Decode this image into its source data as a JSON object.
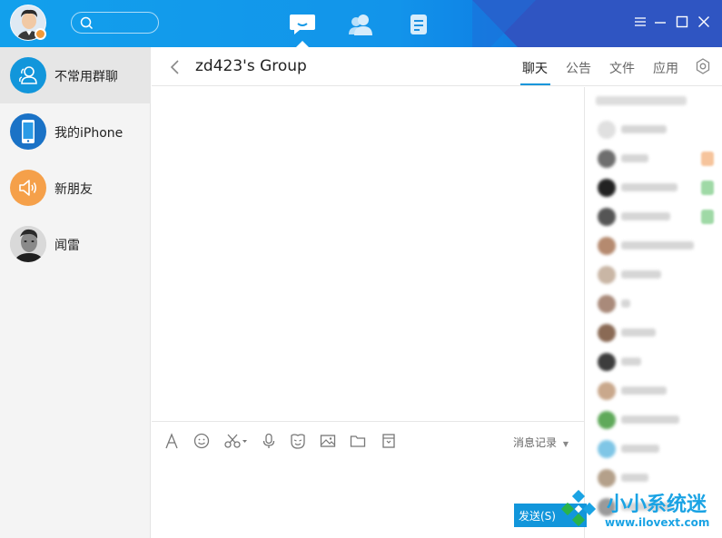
{
  "header": {
    "search_placeholder": ""
  },
  "sidebar": {
    "items": [
      {
        "label": "不常用群聊",
        "icon": "group-icon",
        "color": "#1296db"
      },
      {
        "label": "我的iPhone",
        "icon": "phone-icon",
        "color": "#1a72c6"
      },
      {
        "label": "新朋友",
        "icon": "speaker-icon",
        "color": "#f5a04a"
      },
      {
        "label": "闻雷",
        "icon": "avatar",
        "color": "#cccccc"
      }
    ]
  },
  "chat": {
    "title": "zd423's Group",
    "tabs": [
      {
        "label": "聊天",
        "active": true
      },
      {
        "label": "公告",
        "active": false
      },
      {
        "label": "文件",
        "active": false
      },
      {
        "label": "应用",
        "active": false
      }
    ],
    "toolbar": {
      "history_label": "消息记录"
    },
    "send_label": "发送(S)"
  },
  "watermark": {
    "title": "小小系统迷",
    "url": "www.ilovext.com"
  },
  "colors": {
    "accent": "#1296db",
    "topbar_start": "#12a0ec",
    "topbar_end": "#2f55c2"
  }
}
